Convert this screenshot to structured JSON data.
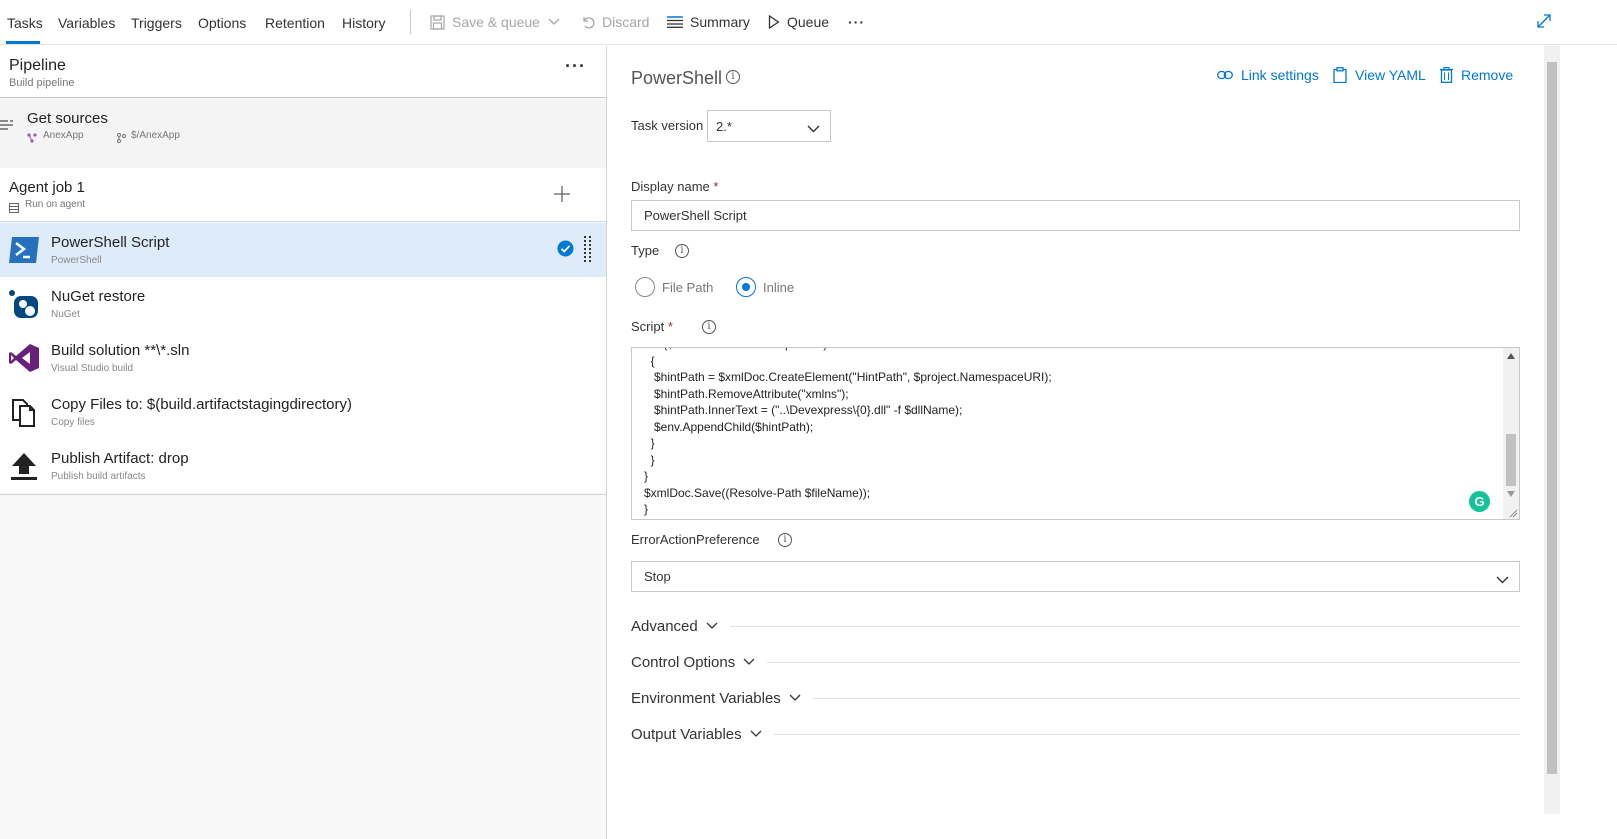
{
  "toolbar": {
    "tabs": [
      "Tasks",
      "Variables",
      "Triggers",
      "Options",
      "Retention",
      "History"
    ],
    "save_queue": "Save & queue",
    "discard": "Discard",
    "summary": "Summary",
    "queue": "Queue",
    "more": "···"
  },
  "pipeline": {
    "title": "Pipeline",
    "subtitle": "Build pipeline",
    "more": "···"
  },
  "get_sources": {
    "title": "Get sources",
    "repo": "AnexApp",
    "branch": "$/AnexApp"
  },
  "agent_job": {
    "title": "Agent job 1",
    "subtitle": "Run on agent"
  },
  "tasks": [
    {
      "title": "PowerShell Script",
      "subtitle": "PowerShell"
    },
    {
      "title": "NuGet restore",
      "subtitle": "NuGet"
    },
    {
      "title": "Build solution **\\*.sln",
      "subtitle": "Visual Studio build"
    },
    {
      "title": "Copy Files to: $(build.artifactstagingdirectory)",
      "subtitle": "Copy files"
    },
    {
      "title": "Publish Artifact: drop",
      "subtitle": "Publish build artifacts"
    }
  ],
  "detail": {
    "title": "PowerShell",
    "link_settings": "Link settings",
    "view_yaml": "View YAML",
    "remove": "Remove",
    "task_version_label": "Task version",
    "task_version": "2.*",
    "display_name_label": "Display name",
    "display_name": "PowerShell Script",
    "type_label": "Type",
    "type_options": [
      "File Path",
      "Inline"
    ],
    "type_selected": "Inline",
    "script_label": "Script",
    "script": "    if($dllName -like \"Devexpress*\")\n  {\n   $hintPath = $xmlDoc.CreateElement(\"HintPath\", $project.NamespaceURI);\n   $hintPath.RemoveAttribute(\"xmlns\");\n   $hintPath.InnerText = (\"..\\Devexpress\\{0}.dll\" -f $dllName);\n   $env.AppendChild($hintPath);\n  }\n  }\n}\n$xmlDoc.Save((Resolve-Path $fileName));\n}",
    "error_pref_label": "ErrorActionPreference",
    "error_pref": "Stop",
    "sections": [
      "Advanced",
      "Control Options",
      "Environment Variables",
      "Output Variables"
    ]
  },
  "colors": {
    "accent": "#0078d4",
    "selected_row": "#deecf9",
    "required": "#a4262c"
  }
}
